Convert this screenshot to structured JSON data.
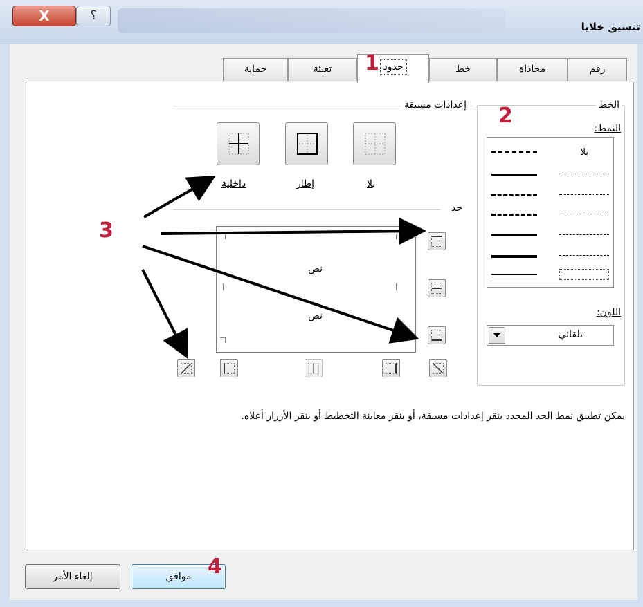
{
  "window": {
    "title": "تنسيق خلايا",
    "close_label": "X",
    "help_label": "؟"
  },
  "tabs": [
    {
      "label": "رقم"
    },
    {
      "label": "محاذاة"
    },
    {
      "label": "خط"
    },
    {
      "label": "حدود",
      "active": true
    },
    {
      "label": "تعبئة"
    },
    {
      "label": "حماية"
    }
  ],
  "line_group": {
    "title": "الخط",
    "style_label": "النمط:",
    "none_label": "بلا",
    "color_label": "اللون:",
    "color_value": "تلقائي"
  },
  "presets": {
    "title": "إعدادات مسبقة",
    "buttons": [
      {
        "label": "بلا"
      },
      {
        "label": "إطار"
      },
      {
        "label": "داخلية"
      }
    ]
  },
  "border": {
    "title": "حد",
    "preview_text": [
      "نص",
      "نص"
    ]
  },
  "hint_text": "يمكن تطبيق نمط الحد المحدد بنقر إعدادات مسبقة، أو بنقر معاينة التخطيط أو بنقر الأزرار أعلاه.",
  "buttons": {
    "ok": "موافق",
    "cancel": "إلغاء الأمر"
  },
  "annotations": [
    "1",
    "2",
    "3",
    "4"
  ],
  "colors": {
    "annotation": "#c0203c",
    "close_button": "#c74332",
    "title_bar": "#dfe9f5"
  }
}
